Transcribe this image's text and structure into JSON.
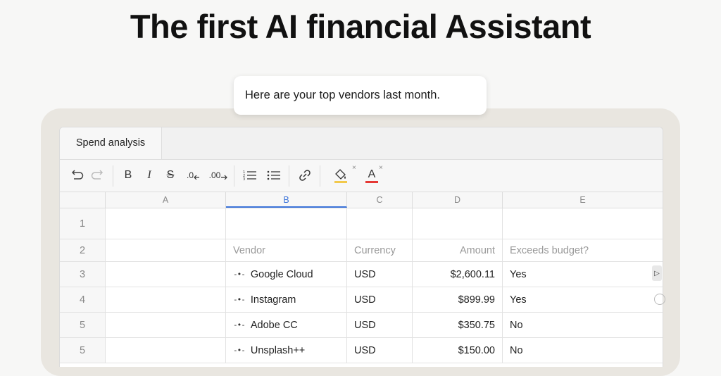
{
  "headline": "The first AI financial Assistant",
  "assistant_message": "Here are your top vendors last month.",
  "sheet": {
    "tab_label": "Spend analysis",
    "columns": [
      "A",
      "B",
      "C",
      "D",
      "E"
    ],
    "header_row": {
      "number": "2",
      "vendor": "Vendor",
      "currency": "Currency",
      "amount": "Amount",
      "exceeds": "Exceeds budget?"
    },
    "empty_row_number": "1",
    "rows": [
      {
        "number": "3",
        "vendor": "Google Cloud",
        "currency": "USD",
        "amount": "$2,600.11",
        "exceeds": "Yes"
      },
      {
        "number": "4",
        "vendor": "Instagram",
        "currency": "USD",
        "amount": "$899.99",
        "exceeds": "Yes"
      },
      {
        "number": "5",
        "vendor": "Adobe CC",
        "currency": "USD",
        "amount": "$350.75",
        "exceeds": "No"
      },
      {
        "number": "5",
        "vendor": "Unsplash++",
        "currency": "USD",
        "amount": "$150.00",
        "exceeds": "No"
      }
    ]
  },
  "toolbar": {
    "undo_icon": "undo-icon",
    "redo_icon": "redo-icon",
    "bold_label": "B",
    "italic_label": "I",
    "strike_label": "S",
    "decrease_decimal_label": ".0",
    "increase_decimal_label": ".00",
    "text_color_label": "A",
    "fill_color": "#f2c94c",
    "text_color": "#e53935",
    "clear_mark": "×"
  },
  "colors": {
    "accent": "#3b73d9",
    "frame": "#e9e6e0"
  }
}
